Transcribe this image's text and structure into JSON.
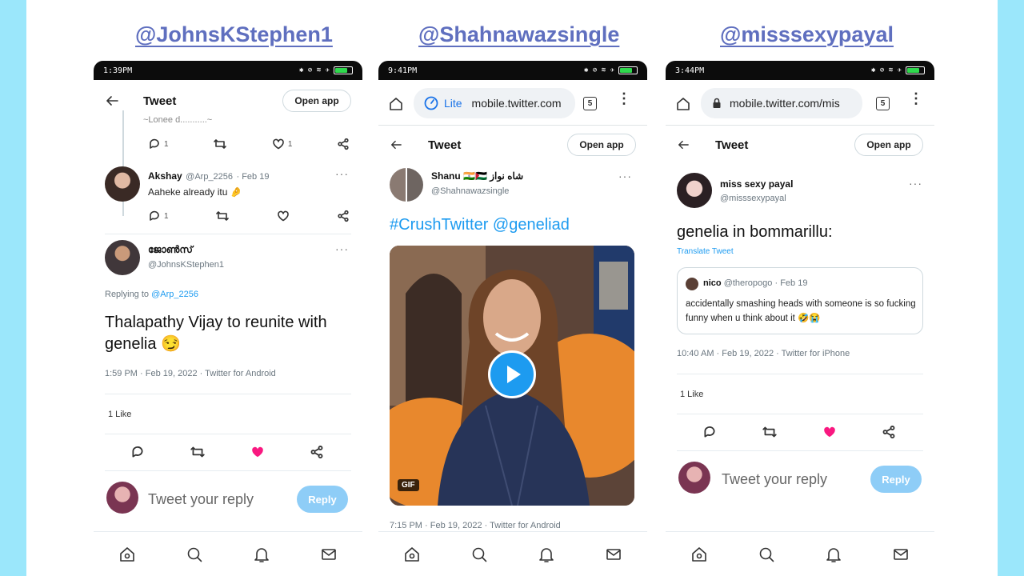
{
  "headings": [
    "@JohnsKStephen1",
    "@Shahnawazsingle",
    "@misssexypayal"
  ],
  "phone1": {
    "time": "1:39PM",
    "header_title": "Tweet",
    "open_app": "Open app",
    "prev_text": "~Lonee d...........~",
    "prev_actions": {
      "reply": "1",
      "like": "1"
    },
    "reply_user": {
      "name": "Akshay",
      "handle": "@Arp_2256",
      "date": "· Feb 19",
      "text": "Aaheke already itu 🤌"
    },
    "reply_actions": {
      "reply": "1"
    },
    "author": {
      "name": "ജോൺസ്",
      "handle": "@JohnsKStephen1"
    },
    "replying_prefix": "Replying to",
    "replying_handle": "@Arp_2256",
    "tweet_text": "Thalapathy Vijay to reunite with genelia 😏",
    "meta": "1:59 PM · Feb 19, 2022 · Twitter for Android",
    "likes": "1 Like",
    "reply_placeholder": "Tweet your reply",
    "reply_button": "Reply"
  },
  "phone2": {
    "time": "9:41PM",
    "url_lite": "Lite",
    "url_text": "mobile.twitter.com",
    "tab_count": "5",
    "header_title": "Tweet",
    "open_app": "Open app",
    "author": {
      "name": "Shanu 🇮🇳🇵🇸 شاه نواز",
      "handle": "@Shahnawazsingle"
    },
    "tweet_text": "#CrushTwitter @geneliad",
    "gif_badge": "GIF",
    "meta": "7:15 PM · Feb 19, 2022 · Twitter for Android"
  },
  "phone3": {
    "time": "3:44PM",
    "url_text": "mobile.twitter.com/mis",
    "tab_count": "5",
    "header_title": "Tweet",
    "open_app": "Open app",
    "author": {
      "name": "miss sexy payal",
      "handle": "@misssexypayal"
    },
    "tweet_text": "genelia in bommarillu:",
    "translate": "Translate Tweet",
    "quote": {
      "name": "nico",
      "handle": "@theropogo",
      "date": "· Feb 19",
      "text": "accidentally smashing heads with someone is so fucking funny when u think about it 🤣😭"
    },
    "meta": "10:40 AM · Feb 19, 2022 · Twitter for iPhone",
    "likes": "1 Like",
    "reply_placeholder": "Tweet your reply",
    "reply_button": "Reply"
  },
  "colors": {
    "accent": "#1d9bf0",
    "like_pink": "#f91880",
    "heading": "#5f6fbf",
    "side_bg": "#9be7fb"
  }
}
